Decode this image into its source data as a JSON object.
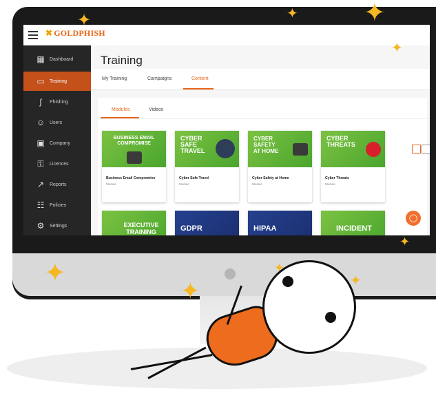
{
  "app": {
    "brand": "GOLDPHISH",
    "brand_mark": "✖"
  },
  "sidebar": {
    "items": [
      {
        "label": "Dashboard",
        "icon": "dashboard-icon",
        "glyph": "▦"
      },
      {
        "label": "Training",
        "icon": "training-icon",
        "glyph": "▭"
      },
      {
        "label": "Phishing",
        "icon": "hook-icon",
        "glyph": "ʃ"
      },
      {
        "label": "Users",
        "icon": "users-icon",
        "glyph": "☺"
      },
      {
        "label": "Company",
        "icon": "company-icon",
        "glyph": "▣"
      },
      {
        "label": "Licences",
        "icon": "key-icon",
        "glyph": "⚿"
      },
      {
        "label": "Reports",
        "icon": "reports-icon",
        "glyph": "↗"
      },
      {
        "label": "Policies",
        "icon": "policies-icon",
        "glyph": "☷"
      },
      {
        "label": "Settings",
        "icon": "settings-icon",
        "glyph": "⚙"
      }
    ],
    "active": "Training"
  },
  "page": {
    "title": "Training"
  },
  "tabs": [
    {
      "label": "My Training"
    },
    {
      "label": "Campaigns"
    },
    {
      "label": "Content",
      "active": true
    }
  ],
  "subtabs": [
    {
      "label": "Modules",
      "active": true
    },
    {
      "label": "Videos"
    }
  ],
  "cards": [
    {
      "thumb_text": "BUSINESS EMAIL COMPROMISE",
      "name": "Business Email Compromise",
      "type": "Module"
    },
    {
      "thumb_text": "CYBER SAFE TRAVEL",
      "name": "Cyber Safe Travel",
      "type": "Module"
    },
    {
      "thumb_text": "CYBER SAFETY AT HOME",
      "name": "Cyber Safety at Home",
      "type": "Module"
    },
    {
      "thumb_text": "CYBER THREATS",
      "name": "Cyber Threats",
      "type": "Module"
    }
  ],
  "cards_row2": [
    {
      "thumb_text": "EXECUTIVE TRAINING"
    },
    {
      "thumb_text": "GDPR"
    },
    {
      "thumb_text": "HIPAA"
    },
    {
      "thumb_text": "INCIDENT"
    }
  ],
  "colors": {
    "accent": "#e8661c",
    "sidebar": "#262626",
    "thumb_green": "#6bbb3c",
    "thumb_blue": "#25408f"
  },
  "chat_icon": "chat-bubble-icon"
}
